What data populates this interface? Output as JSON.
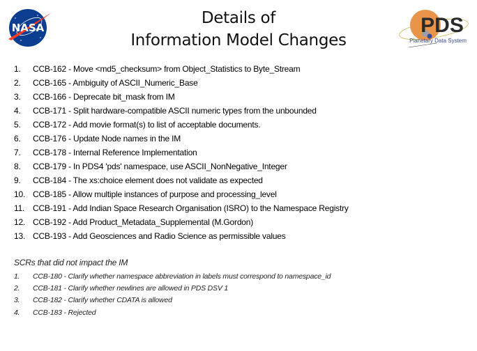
{
  "header": {
    "title_line1": "Details of",
    "title_line2": "Information Model Changes",
    "left_logo": "nasa-logo",
    "left_logo_text": "NASA",
    "right_logo": "pds-logo",
    "right_logo_text": "PDS",
    "right_logo_subtext": "Planetary Data System",
    "colors": {
      "nasa_blue": "#0b3d91",
      "nasa_red": "#fc3d21",
      "pds_orange": "#e8944a",
      "pds_text": "#2a2a2a",
      "pds_subtext": "#3a4a8a"
    }
  },
  "main_list": [
    {
      "num": "1.",
      "text": "CCB-162 - Move <md5_checksum> from Object_Statistics to Byte_Stream"
    },
    {
      "num": "2.",
      "text": "CCB-165 - Ambiguity of ASCII_Numeric_Base"
    },
    {
      "num": "3.",
      "text": "CCB-166 - Deprecate bit_mask from IM"
    },
    {
      "num": "4.",
      "text": "CCB-171 - Split hardware-compatible ASCII numeric types from the unbounded"
    },
    {
      "num": "5.",
      "text": "CCB-172 - Add movie format(s) to list of acceptable documents."
    },
    {
      "num": "6.",
      "text": "CCB-176 - Update Node names in the IM"
    },
    {
      "num": "7.",
      "text": "CCB-178 - Internal Reference Implementation"
    },
    {
      "num": "8.",
      "text": "CCB-179 - In PDS4 'pds' namespace, use ASCII_NonNegative_Integer"
    },
    {
      "num": "9.",
      "text": "CCB-184 - The xs:choice element does not validate as expected"
    },
    {
      "num": "10.",
      "text": "CCB-185 - Allow multiple instances of purpose and processing_level"
    },
    {
      "num": "11.",
      "text": "CCB-191 - Add Indian Space Research Organisation (ISRO) to the Namespace Registry"
    },
    {
      "num": "12.",
      "text": "CCB-192 - Add Product_Metadata_Supplemental (M.Gordon)"
    },
    {
      "num": "13.",
      "text": "CCB-193 - Add Geosciences and Radio Science as permissible values"
    }
  ],
  "secondary": {
    "heading": "SCRs that did not impact the IM",
    "items": [
      {
        "num": "1.",
        "text": "CCB-180 - Clarify whether namespace abbreviation in labels must correspond to namespace_id"
      },
      {
        "num": "2.",
        "text": "CCB-181 - Clarify whether newlines are allowed in PDS DSV 1"
      },
      {
        "num": "3.",
        "text": "CCB-182 - Clarify whether CDATA is allowed"
      },
      {
        "num": "4.",
        "text": "CCB-183 - Rejected"
      }
    ]
  }
}
